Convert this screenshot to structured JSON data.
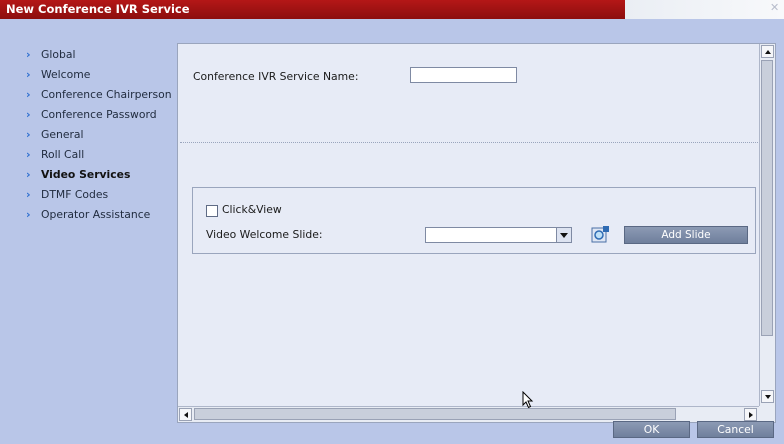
{
  "window": {
    "title": "New Conference IVR Service"
  },
  "sidebar": {
    "items": [
      {
        "label": "Global"
      },
      {
        "label": "Welcome"
      },
      {
        "label": "Conference Chairperson"
      },
      {
        "label": "Conference Password"
      },
      {
        "label": "General"
      },
      {
        "label": "Roll Call"
      },
      {
        "label": "Video Services",
        "active": true
      },
      {
        "label": "DTMF Codes"
      },
      {
        "label": "Operator Assistance"
      }
    ]
  },
  "form": {
    "service_name_label": "Conference IVR Service Name:",
    "service_name_value": "",
    "clickview_label": "Click&View",
    "clickview_checked": false,
    "welcome_slide_label": "Video Welcome Slide:",
    "welcome_slide_value": "",
    "add_slide_label": "Add Slide"
  },
  "footer": {
    "ok_label": "OK",
    "cancel_label": "Cancel"
  },
  "colors": {
    "title_bar": "#a81414",
    "dialog_bg": "#b9c6e8",
    "panel_bg": "#e7ebf6",
    "button": "#7f8da8",
    "nav_chevron": "#2d6fcf"
  }
}
